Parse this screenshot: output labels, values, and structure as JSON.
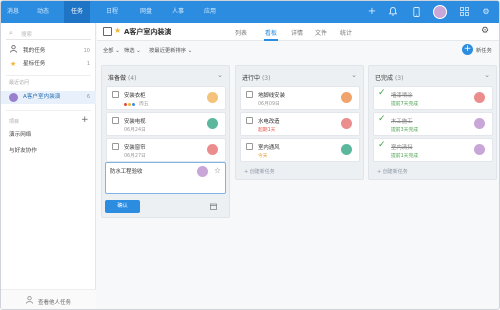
{
  "topnav": {
    "items": [
      "消息",
      "动态",
      "任务",
      "日程",
      "网盘",
      "人事",
      "应用"
    ],
    "active_index": 2,
    "icons": [
      "plus-icon",
      "bell-icon",
      "phone-icon",
      "avatar",
      "grid-icon",
      "settings-icon"
    ]
  },
  "sidebar": {
    "search_placeholder": "搜索",
    "my_tasks": {
      "label": "我的任务",
      "count": "10"
    },
    "starred": {
      "label": "星标任务",
      "count": "1"
    },
    "recent_header": "最近访问",
    "recent_project": {
      "label": "A客户室内装演",
      "count": "6"
    },
    "projects_header": "项目",
    "projects": [
      "演示网络",
      "与好友协作"
    ],
    "footer_label": "查看他人任务"
  },
  "project": {
    "title": "A客户室内装演",
    "tabs": [
      "列表",
      "看板",
      "详情",
      "文件",
      "统计"
    ],
    "active_tab": 1
  },
  "filters": {
    "all": "全部",
    "filter": "筛选",
    "sort": "按最近更新排序",
    "new_task": "新任务"
  },
  "columns": [
    {
      "title": "准备做",
      "count": "(4)",
      "cards": [
        {
          "title": "安装衣柜",
          "sub": "周五",
          "status": "normal",
          "dots": [
            "#e24b3b",
            "#f2b530",
            "#3c8fe0"
          ],
          "avatar": "#f4c27a"
        },
        {
          "title": "安装电视",
          "sub": "06月24日",
          "status": "normal",
          "avatar": "#5cb89c"
        },
        {
          "title": "安装窗帘",
          "sub": "06月27日",
          "status": "normal",
          "avatar": "#ec8d8d"
        },
        {
          "title": "防水工程验收",
          "status": "editing",
          "avatar": "#c9a6d8"
        }
      ],
      "confirm": "确认"
    },
    {
      "title": "进行中",
      "count": "(3)",
      "cards": [
        {
          "title": "地脚线安装",
          "sub": "06月09日",
          "status": "normal",
          "avatar": "#f0a46b"
        },
        {
          "title": "水电改造",
          "sub": "超期1天",
          "status": "red",
          "avatar": "#ec8d8d"
        },
        {
          "title": "室内通风",
          "sub": "今天",
          "status": "green",
          "avatar": "#5cb89c"
        }
      ],
      "add_task": "+ 创建新任务"
    },
    {
      "title": "已完成",
      "count": "(3)",
      "cards": [
        {
          "title": "墙漆喷涂",
          "sub": "提前7天完成",
          "status": "done",
          "avatar": "#ec8d8d"
        },
        {
          "title": "木工施工",
          "sub": "提前3天完成",
          "status": "done",
          "avatar": "#c9a6d8"
        },
        {
          "title": "室内清扫",
          "sub": "提前1天完成",
          "status": "done",
          "avatar": "#c9a6d8"
        }
      ],
      "add_task": "+ 创建新任务"
    }
  ]
}
